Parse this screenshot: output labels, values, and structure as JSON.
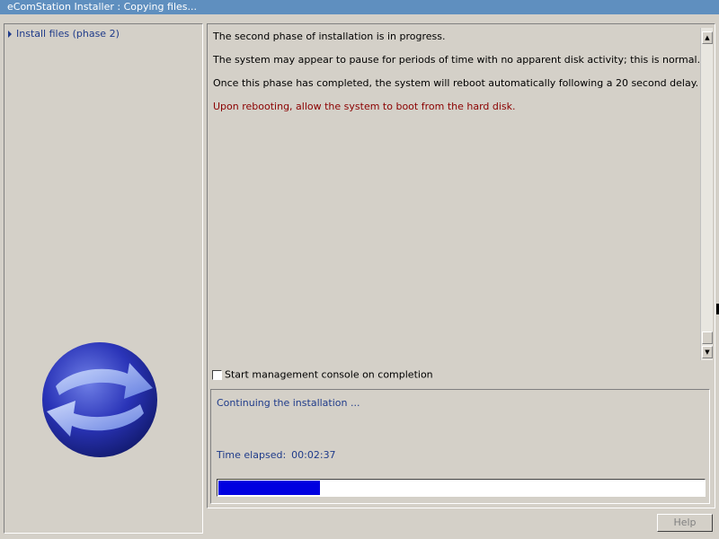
{
  "window": {
    "title": "eComStation Installer : Copying files..."
  },
  "sidebar": {
    "items": [
      {
        "label": "Install files (phase 2)",
        "icon": "triangle-right-icon"
      }
    ]
  },
  "info": {
    "lines": [
      "The second phase of installation is in progress.",
      "The system may appear to pause for periods of time with no apparent disk activity; this is normal.",
      "Once this phase has completed, the system will reboot automatically following a 20 second delay.",
      "Upon rebooting, allow the system to boot from the hard disk."
    ],
    "highlight_color": "#8b0000"
  },
  "checkbox": {
    "label": "Start management console on completion",
    "checked": false
  },
  "status": {
    "message": "Continuing the installation ...",
    "elapsed_label": "Time elapsed:",
    "elapsed_value": "00:02:37",
    "progress": 0.21,
    "progress_color": "#0000e0"
  },
  "buttons": {
    "help": "Help"
  }
}
